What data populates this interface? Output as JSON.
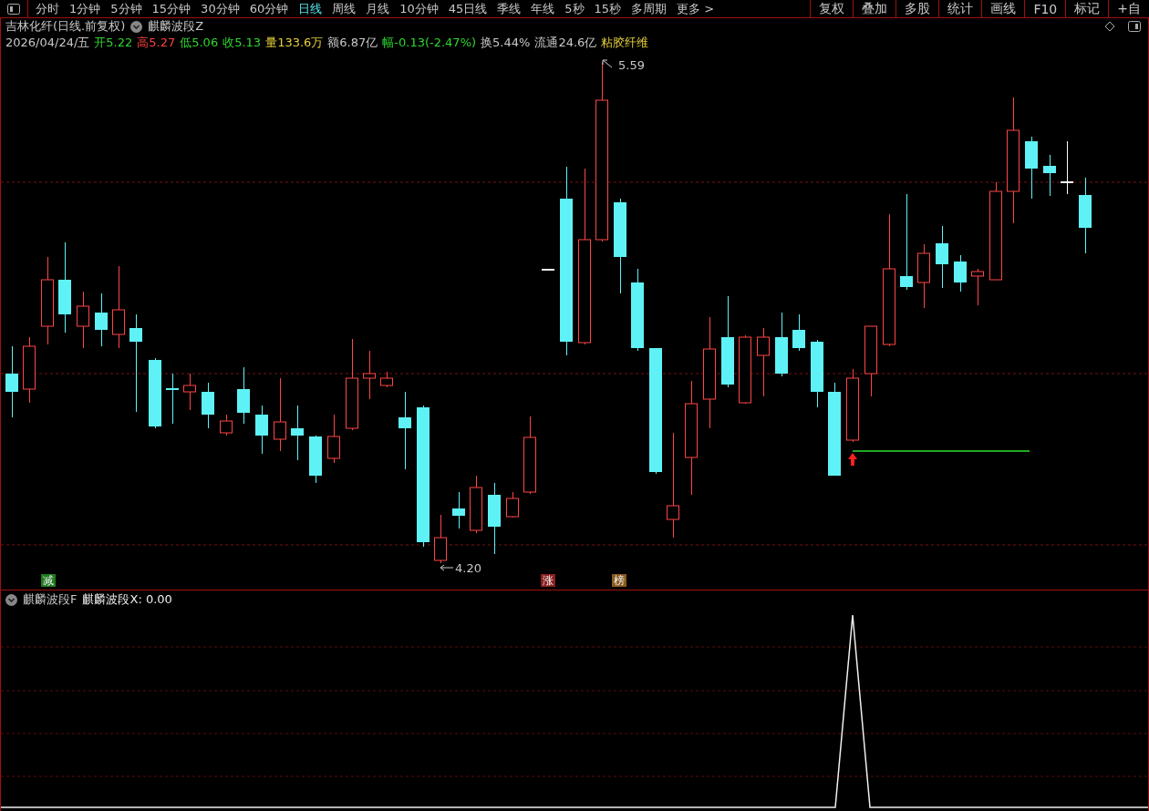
{
  "toolbar": {
    "periods": [
      {
        "label": "分时",
        "selected": false
      },
      {
        "label": "1分钟",
        "selected": false
      },
      {
        "label": "5分钟",
        "selected": false
      },
      {
        "label": "15分钟",
        "selected": false
      },
      {
        "label": "30分钟",
        "selected": false
      },
      {
        "label": "60分钟",
        "selected": false
      },
      {
        "label": "日线",
        "selected": true
      },
      {
        "label": "周线",
        "selected": false
      },
      {
        "label": "月线",
        "selected": false
      },
      {
        "label": "10分钟",
        "selected": false
      },
      {
        "label": "45日线",
        "selected": false
      },
      {
        "label": "季线",
        "selected": false
      },
      {
        "label": "年线",
        "selected": false
      },
      {
        "label": "5秒",
        "selected": false
      },
      {
        "label": "15秒",
        "selected": false
      },
      {
        "label": "多周期",
        "selected": false
      },
      {
        "label": "更多 >",
        "selected": false
      }
    ],
    "tools": [
      "复权",
      "叠加",
      "多股",
      "统计",
      "画线",
      "F10",
      "标记",
      "+自"
    ]
  },
  "header": {
    "title": "吉林化纤(日线.前复权)",
    "indicator": "麒麟波段Z"
  },
  "quote": {
    "date": "2026/04/24/五",
    "items": [
      {
        "label": "开",
        "value": "5.22",
        "color": "#2fd62f"
      },
      {
        "label": "高",
        "value": "5.27",
        "color": "#ff4040"
      },
      {
        "label": "低",
        "value": "5.06",
        "color": "#2fd62f"
      },
      {
        "label": "收",
        "value": "5.13",
        "color": "#2fd62f"
      },
      {
        "label": "量",
        "value": "133.6万",
        "color": "#e6cf3c"
      },
      {
        "label": "额",
        "value": "6.87亿",
        "color": "#c8c8c8"
      },
      {
        "label": "幅",
        "value": "-0.13(-2.47%)",
        "color": "#2fd62f"
      },
      {
        "label": "换",
        "value": "5.44%",
        "color": "#c8c8c8"
      },
      {
        "label": "流通",
        "value": "24.6亿",
        "color": "#c8c8c8"
      }
    ],
    "sector": "粘胶纤维"
  },
  "chart": {
    "high_label": "5.59",
    "low_label": "4.20",
    "markers": [
      {
        "text": "减",
        "color": "#1f7a1f"
      },
      {
        "text": "涨",
        "color": "#8a1f1f"
      },
      {
        "text": "榜",
        "color": "#8a5a1f"
      }
    ]
  },
  "sub_panel": {
    "name": "麒麟波段F",
    "reading": "麒麟波段X: 0.00"
  }
}
